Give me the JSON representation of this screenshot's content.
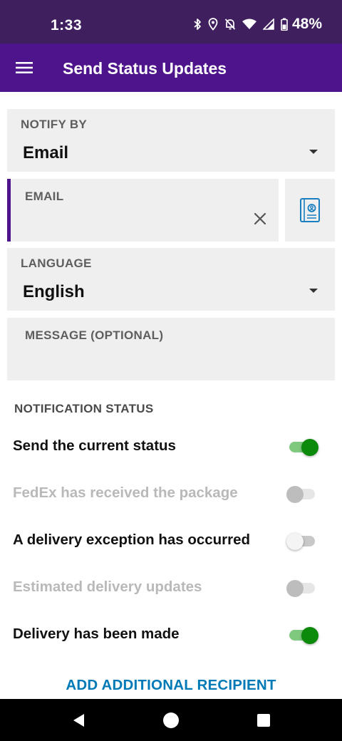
{
  "status_bar": {
    "time": "1:33",
    "battery_percent": "48%",
    "icons": [
      "bluetooth-icon",
      "location-icon",
      "notifications-off-icon",
      "wifi-icon",
      "signal-icon",
      "battery-icon"
    ]
  },
  "app_bar": {
    "title": "Send Status Updates",
    "menu_icon": "menu-icon"
  },
  "form": {
    "notify_by": {
      "label": "NOTIFY BY",
      "value": "Email"
    },
    "email": {
      "label": "EMAIL",
      "value": "",
      "clear_icon": "close-icon",
      "contact_icon": "contacts-book-icon"
    },
    "language": {
      "label": "LANGUAGE",
      "value": "English"
    },
    "message": {
      "label": "MESSAGE (OPTIONAL)",
      "value": ""
    }
  },
  "notification_status": {
    "title": "NOTIFICATION STATUS",
    "items": [
      {
        "label": "Send the current status",
        "on": true,
        "enabled": true
      },
      {
        "label": "FedEx has received the package",
        "on": false,
        "enabled": false
      },
      {
        "label": "A delivery exception has occurred",
        "on": false,
        "enabled": true
      },
      {
        "label": "Estimated delivery updates",
        "on": false,
        "enabled": false
      },
      {
        "label": "Delivery has been made",
        "on": true,
        "enabled": true
      }
    ]
  },
  "add_recipient_label": "ADD ADDITIONAL RECIPIENT",
  "nav_bar": {
    "icons": [
      "back-icon",
      "home-icon",
      "recents-icon"
    ]
  },
  "colors": {
    "status_bar": "#3f1f5e",
    "app_bar": "#4d148c",
    "field_bg": "#efefef",
    "toggle_on": "#0b8a0b",
    "link": "#007ab7"
  }
}
